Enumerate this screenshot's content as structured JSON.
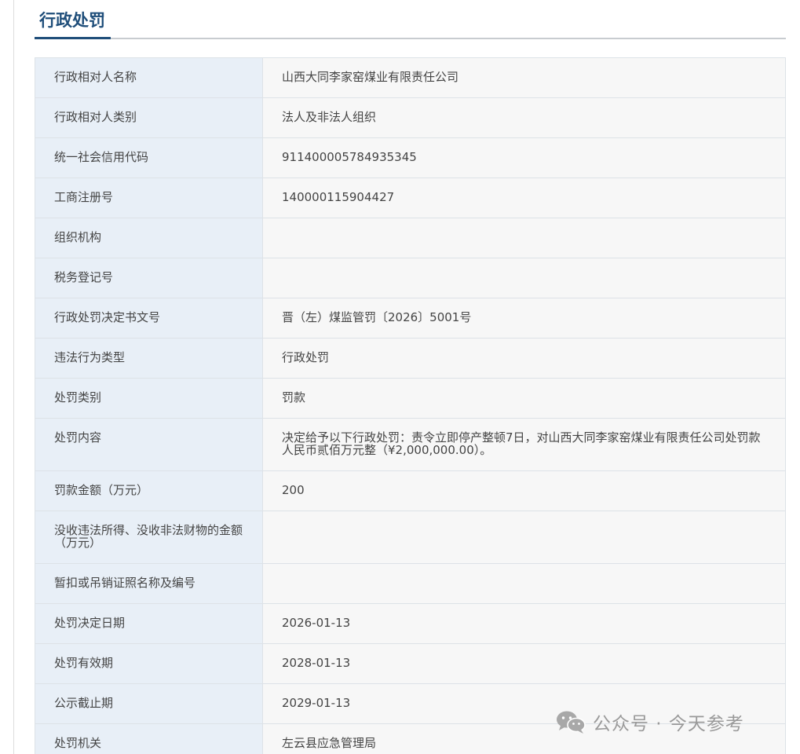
{
  "section": {
    "title": "行政处罚"
  },
  "rows": [
    {
      "label": "行政相对人名称",
      "value": "山西大同李家窑煤业有限责任公司"
    },
    {
      "label": "行政相对人类别",
      "value": "法人及非法人组织"
    },
    {
      "label": "统一社会信用代码",
      "value": "911400005784935345"
    },
    {
      "label": "工商注册号",
      "value": "140000115904427"
    },
    {
      "label": "组织机构",
      "value": ""
    },
    {
      "label": "税务登记号",
      "value": ""
    },
    {
      "label": "行政处罚决定书文号",
      "value": "晋（左）煤监管罚〔2026〕5001号"
    },
    {
      "label": "违法行为类型",
      "value": "行政处罚"
    },
    {
      "label": "处罚类别",
      "value": "罚款"
    },
    {
      "label": "处罚内容",
      "value": "决定给予以下行政处罚：责令立即停产整顿7日，对山西大同李家窑煤业有限责任公司处罚款人民币贰佰万元整（¥2,000,000.00）。"
    },
    {
      "label": "罚款金额（万元）",
      "value": "200"
    },
    {
      "label": "没收违法所得、没收非法财物的金额（万元）",
      "value": ""
    },
    {
      "label": "暂扣或吊销证照名称及编号",
      "value": ""
    },
    {
      "label": "处罚决定日期",
      "value": "2026-01-13"
    },
    {
      "label": "处罚有效期",
      "value": "2028-01-13"
    },
    {
      "label": "公示截止期",
      "value": "2029-01-13"
    },
    {
      "label": "处罚机关",
      "value": "左云县应急管理局"
    }
  ],
  "watermark": {
    "icon": "wechat-icon",
    "text": "公众号 · 今天参考"
  }
}
